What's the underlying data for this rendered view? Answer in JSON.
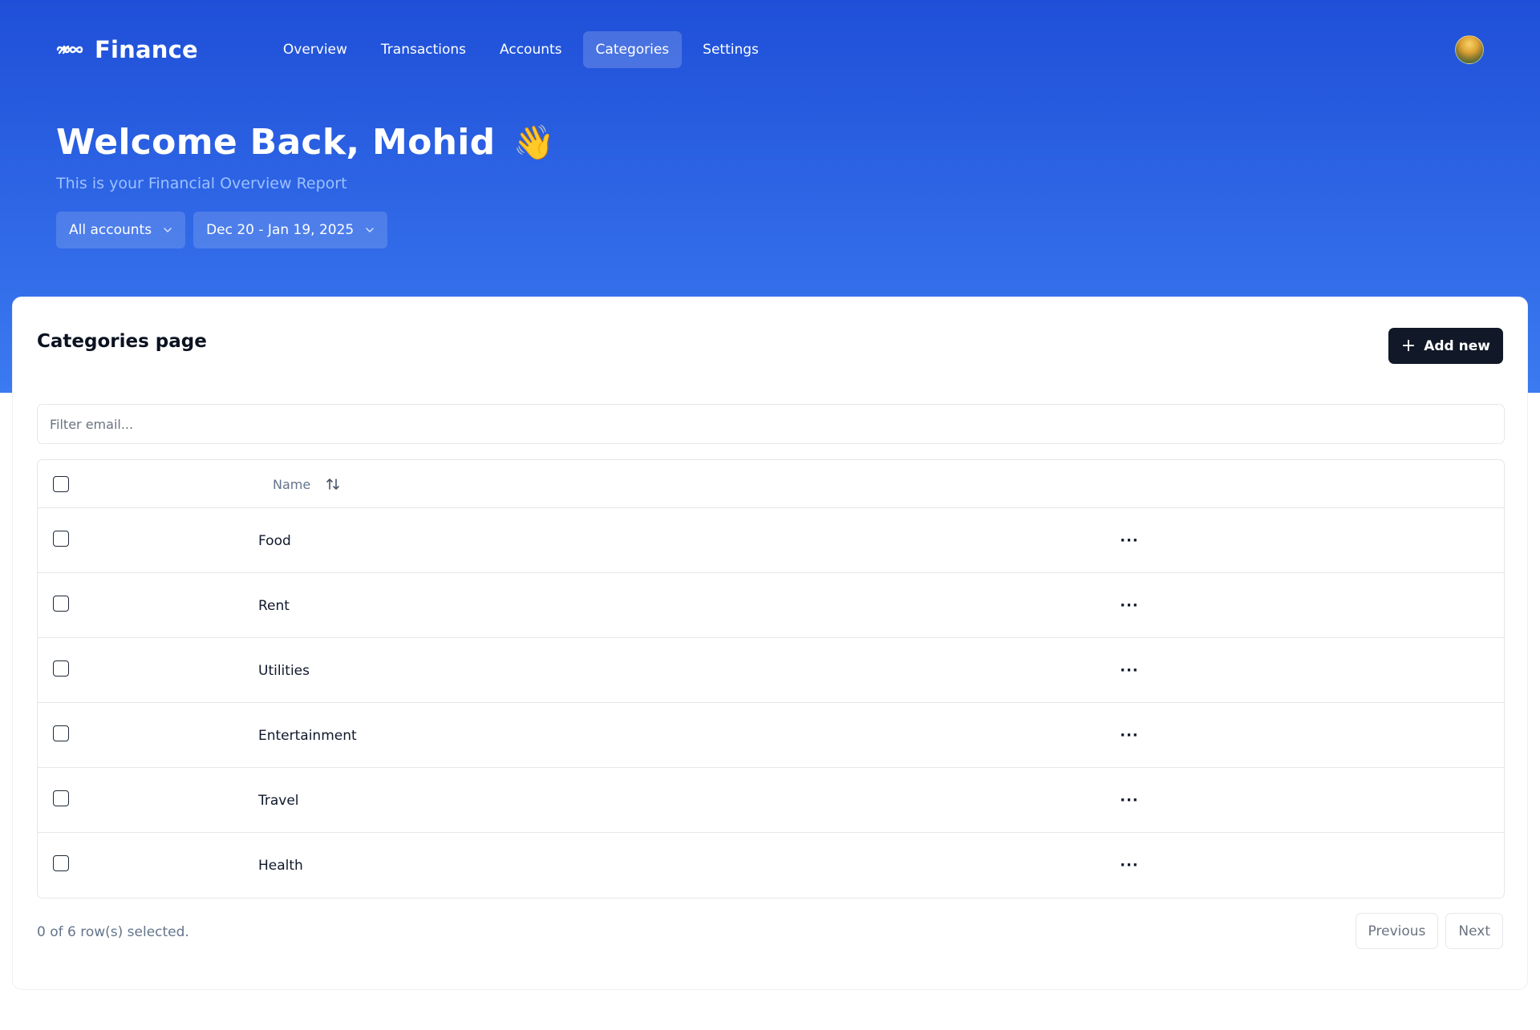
{
  "app": {
    "logo_text": "Finance"
  },
  "nav": {
    "items": [
      {
        "label": "Overview",
        "active": false
      },
      {
        "label": "Transactions",
        "active": false
      },
      {
        "label": "Accounts",
        "active": false
      },
      {
        "label": "Categories",
        "active": true
      },
      {
        "label": "Settings",
        "active": false
      }
    ]
  },
  "header": {
    "greeting": "Welcome Back, Mohid",
    "wave_emoji": "👋",
    "subtitle": "This is your Financial Overview Report",
    "account_filter": "All accounts",
    "date_filter": "Dec 20 - Jan 19, 2025"
  },
  "card": {
    "title": "Categories page",
    "add_label": "Add new",
    "filter_placeholder": "Filter email..."
  },
  "table": {
    "name_header": "Name",
    "rows": [
      {
        "name": "Food"
      },
      {
        "name": "Rent"
      },
      {
        "name": "Utilities"
      },
      {
        "name": "Entertainment"
      },
      {
        "name": "Travel"
      },
      {
        "name": "Health"
      }
    ],
    "row_action": "···"
  },
  "footer": {
    "selection_text": "0 of 6 row(s) selected.",
    "previous_label": "Previous",
    "next_label": "Next"
  },
  "colors": {
    "brand_blue": "#2f67e6",
    "primary_button": "#111827"
  },
  "icons": {
    "logo": "infinity-link-icon",
    "chevron": "chevron-down-icon",
    "sort": "sort-arrows-icon",
    "more": "more-horizontal-icon",
    "plus": "plus-icon"
  }
}
